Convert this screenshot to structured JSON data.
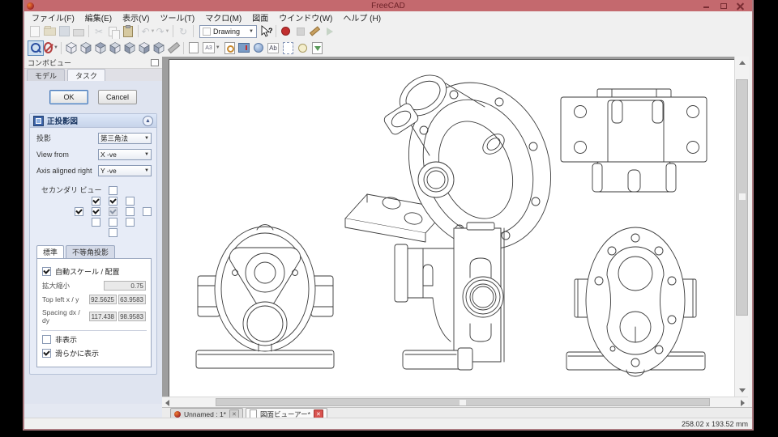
{
  "window": {
    "title": "FreeCAD"
  },
  "menu": {
    "items": [
      "ファイル(F)",
      "編集(E)",
      "表示(V)",
      "ツール(T)",
      "マクロ(M)",
      "図面",
      "ウインドウ(W)",
      "ヘルプ (H)"
    ]
  },
  "toolbars": {
    "workbench_selector": "Drawing",
    "page_size_label": "A3",
    "annotation_label": "Ab"
  },
  "combo_view": {
    "title": "コンボビュー",
    "model_tab": "モデル",
    "task_tab": "タスク",
    "ok": "OK",
    "cancel": "Cancel",
    "ortho": {
      "title": "正投影図",
      "projection_label": "投影",
      "projection_value": "第三角法",
      "view_from_label": "View from",
      "view_from_value": "X -ve",
      "axis_label": "Axis aligned right",
      "axis_value": "Y -ve",
      "secondary_label": "セカンダリ ビュー",
      "grid": [
        [
          "",
          "",
          "u",
          "",
          ""
        ],
        [
          "",
          "c",
          "c",
          "u",
          ""
        ],
        [
          "c",
          "c",
          "d",
          "u",
          "u"
        ],
        [
          "",
          "u",
          "u",
          "u",
          ""
        ],
        [
          "",
          "",
          "u",
          "",
          ""
        ]
      ],
      "general_tab": "標準",
      "axono_tab": "不等角投影",
      "auto_scale": "自動スケール / 配置",
      "scale_label": "拡大縮小",
      "scale_value": "0.75",
      "top_left_label": "Top left x / y",
      "top_left_x": "92.5625",
      "top_left_y": "63.9583",
      "spacing_label": "Spacing dx / dy",
      "spacing_dx": "117.438",
      "spacing_dy": "98.9583",
      "hidden": "非表示",
      "smooth": "滑らかに表示"
    }
  },
  "document_tabs": [
    {
      "label": "Unnamed : 1*"
    },
    {
      "label": "図面ビューアー*"
    }
  ],
  "status": {
    "dimensions": "258.02 x 193.52 mm"
  },
  "colors": {
    "titlebar": "#c4696e",
    "task_fill": "#3b3b6d",
    "record_red": "#c23030"
  }
}
